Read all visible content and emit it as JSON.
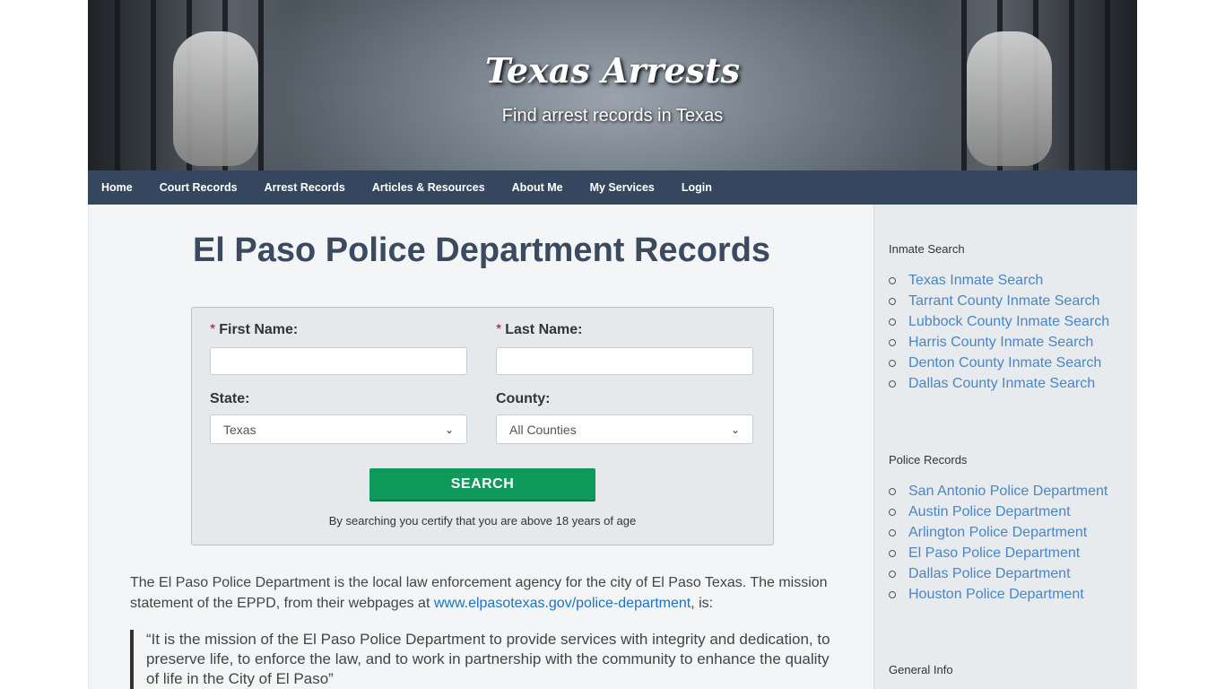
{
  "header": {
    "title": "Texas Arrests",
    "subtitle": "Find arrest records in Texas"
  },
  "nav": [
    "Home",
    "Court Records",
    "Arrest Records",
    "Articles & Resources",
    "About Me",
    "My Services",
    "Login"
  ],
  "main": {
    "title": "El Paso Police Department Records",
    "form": {
      "required_mark": "*",
      "first_name_label": "First Name:",
      "last_name_label": "Last Name:",
      "first_name_value": "",
      "last_name_value": "",
      "state_label": "State:",
      "state_value": "Texas",
      "county_label": "County:",
      "county_value": "All Counties",
      "search_button": "SEARCH",
      "certify_text": "By searching you certify that you are above 18 years of age"
    },
    "intro_text_1": "The El Paso Police Department is the local law enforcement agency for the city of El Paso Texas. The mission statement of the EPPD, from their webpages at ",
    "intro_link": "www.elpasotexas.gov/police-department",
    "intro_text_2": ", is:",
    "quote": "“It is the mission of the El Paso Police Department to provide services with integrity and dedication, to preserve life, to enforce the law, and to work in partnership with the community to enhance the quality of life in the City of El Paso”"
  },
  "sidebar": {
    "inmate_heading": "Inmate Search",
    "inmate_links": [
      "Texas Inmate Search",
      "Tarrant County Inmate Search",
      "Lubbock County Inmate Search",
      "Harris County Inmate Search",
      "Denton County Inmate Search",
      "Dallas County Inmate Search"
    ],
    "police_heading": "Police Records",
    "police_links": [
      "San Antonio Police Department",
      "Austin Police Department",
      "Arlington Police Department",
      "El Paso Police Department",
      "Dallas Police Department",
      "Houston Police Department"
    ],
    "general_heading": "General Info"
  },
  "colors": {
    "nav_bg": "#34475e",
    "button": "#0f9a5c",
    "link": "#4a86c5",
    "title": "#3b4a5e"
  }
}
